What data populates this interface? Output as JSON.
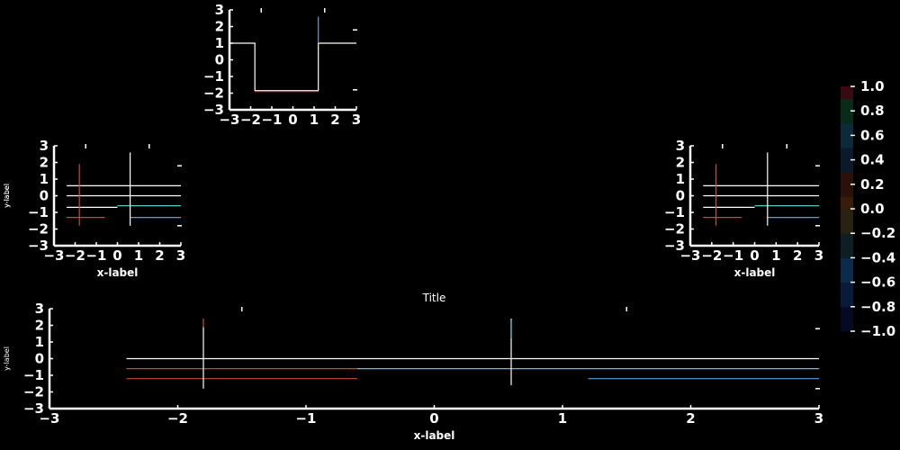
{
  "background": "#000000",
  "foreground": "#ffffff",
  "chart_data": [
    {
      "type": "line",
      "panel": "top-center",
      "title": "",
      "xlabel": "",
      "ylabel": "",
      "xlim": [
        -3,
        3
      ],
      "ylim": [
        -3,
        3
      ],
      "xticks": [
        "−3",
        "−2",
        "−1",
        "0",
        "1",
        "2",
        "3"
      ],
      "yticks": [
        "−3",
        "−2",
        "−1",
        "0",
        "1",
        "2",
        "3"
      ],
      "grid": false,
      "series": [
        {
          "color": "#ffffff",
          "x": [
            -3,
            -1.8,
            -1.8,
            1.2,
            1.2,
            3
          ],
          "y": [
            1,
            1,
            -1.85,
            -1.85,
            1,
            1
          ]
        },
        {
          "color": "#cc4a3a",
          "x": [
            -1.8,
            1.2
          ],
          "y": [
            -1.9,
            -1.9
          ]
        },
        {
          "color": "#5aa0d8",
          "x": [
            1.2,
            1.2
          ],
          "y": [
            1,
            2.6
          ]
        }
      ]
    },
    {
      "type": "line",
      "panel": "middle-left",
      "title": "",
      "xlabel": "x-label",
      "ylabel": "y-label",
      "xlim": [
        -3,
        3
      ],
      "ylim": [
        -3,
        3
      ],
      "xticks": [
        "−3",
        "−2",
        "−1",
        "0",
        "1",
        "2",
        "3"
      ],
      "yticks": [
        "−3",
        "−2",
        "−1",
        "0",
        "1",
        "2",
        "3"
      ],
      "grid": false,
      "series": [
        {
          "color": "#ffffff",
          "x": [
            -2.4,
            3
          ],
          "y": [
            0.6,
            0.6
          ]
        },
        {
          "color": "#ffffff",
          "x": [
            -2.4,
            3
          ],
          "y": [
            0,
            0
          ]
        },
        {
          "color": "#ffffff",
          "x": [
            -2.4,
            0
          ],
          "y": [
            -0.7,
            -0.7
          ]
        },
        {
          "color": "#5ac8c8",
          "x": [
            0,
            3
          ],
          "y": [
            -0.6,
            -0.6
          ]
        },
        {
          "color": "#cc4a3a",
          "x": [
            -2.4,
            -0.6
          ],
          "y": [
            -1.3,
            -1.3
          ]
        },
        {
          "color": "#5aa0d8",
          "x": [
            0.6,
            3
          ],
          "y": [
            -1.3,
            -1.3
          ]
        },
        {
          "color": "#ffffff",
          "x": [
            0.6,
            0.6
          ],
          "y": [
            -1.8,
            2.6
          ]
        },
        {
          "color": "#cc4a3a",
          "x": [
            -1.8,
            -1.8
          ],
          "y": [
            -1.8,
            1.9
          ]
        }
      ]
    },
    {
      "type": "line",
      "panel": "middle-right",
      "title": "",
      "xlabel": "x-label",
      "ylabel": "y-label",
      "xlim": [
        -3,
        3
      ],
      "ylim": [
        -3,
        3
      ],
      "xticks": [
        "−3",
        "−2",
        "−1",
        "0",
        "1",
        "2",
        "3"
      ],
      "yticks": [
        "−3",
        "−2",
        "−1",
        "0",
        "1",
        "2",
        "3"
      ],
      "grid": false,
      "series": [
        {
          "color": "#ffffff",
          "x": [
            -2.4,
            3
          ],
          "y": [
            0.6,
            0.6
          ]
        },
        {
          "color": "#ffffff",
          "x": [
            -2.4,
            3
          ],
          "y": [
            0,
            0
          ]
        },
        {
          "color": "#ffffff",
          "x": [
            -2.4,
            0
          ],
          "y": [
            -0.7,
            -0.7
          ]
        },
        {
          "color": "#5ac8c8",
          "x": [
            0,
            3
          ],
          "y": [
            -0.6,
            -0.6
          ]
        },
        {
          "color": "#cc4a3a",
          "x": [
            -2.4,
            -0.6
          ],
          "y": [
            -1.3,
            -1.3
          ]
        },
        {
          "color": "#5aa0d8",
          "x": [
            0.6,
            3
          ],
          "y": [
            -1.3,
            -1.3
          ]
        },
        {
          "color": "#ffffff",
          "x": [
            0.6,
            0.6
          ],
          "y": [
            -1.8,
            2.6
          ]
        },
        {
          "color": "#cc4a3a",
          "x": [
            -1.8,
            -1.8
          ],
          "y": [
            -1.8,
            1.9
          ]
        }
      ]
    },
    {
      "type": "line",
      "panel": "bottom-wide",
      "title": "Title",
      "xlabel": "x-label",
      "ylabel": "y-label",
      "xlim": [
        -3,
        3
      ],
      "ylim": [
        -3,
        3
      ],
      "xticks": [
        "−3",
        "−2",
        "−1",
        "0",
        "1",
        "2",
        "3"
      ],
      "yticks": [
        "−3",
        "−2",
        "−1",
        "0",
        "1",
        "2",
        "3"
      ],
      "grid": false,
      "series": [
        {
          "color": "#ffffff",
          "x": [
            -2.4,
            3
          ],
          "y": [
            0,
            0
          ]
        },
        {
          "color": "#cc4a3a",
          "x": [
            -2.4,
            -0.6
          ],
          "y": [
            -0.6,
            -0.6
          ]
        },
        {
          "color": "#5ac8c8",
          "x": [
            -0.6,
            3
          ],
          "y": [
            -0.6,
            -0.6
          ]
        },
        {
          "color": "#cc4a3a",
          "x": [
            -2.4,
            -0.6
          ],
          "y": [
            -1.2,
            -1.2
          ]
        },
        {
          "color": "#5aa0d8",
          "x": [
            1.2,
            3
          ],
          "y": [
            -1.2,
            -1.2
          ]
        },
        {
          "color": "#ffffff",
          "x": [
            -1.8,
            -1.8
          ],
          "y": [
            -1.8,
            1.9
          ]
        },
        {
          "color": "#cc4a3a",
          "x": [
            -1.8,
            -1.8
          ],
          "y": [
            1.9,
            2.4
          ]
        },
        {
          "color": "#ffffff",
          "x": [
            0.6,
            0.6
          ],
          "y": [
            -1.6,
            2.4
          ]
        },
        {
          "color": "#5ac8c8",
          "x": [
            0.6,
            0.6
          ],
          "y": [
            1.2,
            2.3
          ]
        }
      ]
    },
    {
      "type": "heatmap",
      "panel": "colorbar",
      "orientation": "vertical",
      "ticks": [
        "1.0",
        "0.8",
        "0.6",
        "0.4",
        "0.2",
        "0.0",
        "−0.2",
        "−0.4",
        "−0.6",
        "−0.8",
        "−1.0"
      ],
      "tick_values": [
        1.0,
        0.8,
        0.6,
        0.4,
        0.2,
        0.0,
        -0.2,
        -0.4,
        -0.6,
        -0.8,
        -1.0
      ],
      "vmin": -1.0,
      "vmax": 1.0
    }
  ]
}
